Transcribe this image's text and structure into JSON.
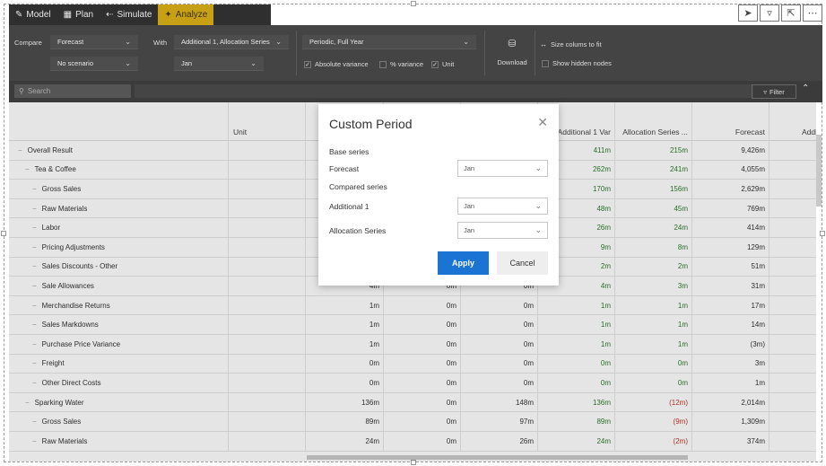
{
  "nav": {
    "tabs": [
      {
        "label": "Model",
        "icon": "wrench-icon"
      },
      {
        "label": "Plan",
        "icon": "table-icon"
      },
      {
        "label": "Simulate",
        "icon": "simulate-icon"
      },
      {
        "label": "Analyze",
        "icon": "analyze-icon",
        "active": true
      }
    ],
    "accent_color": "#c7a015"
  },
  "toolbar": {
    "compare_label": "Compare",
    "compare_value": "Forecast",
    "scenario_value": "No scenario",
    "with_label": "With",
    "with_value": "Additional 1, Allocation Series",
    "with_period": "Jan",
    "period_value": "Periodic, Full Year",
    "abs_variance": "Absolute variance",
    "pct_variance": "% variance",
    "unit": "Unit",
    "download": "Download",
    "size_columns": "Size colums to fit",
    "show_hidden": "Show hidden nodes"
  },
  "search": {
    "placeholder": "Search",
    "filter_label": "Filter"
  },
  "grid": {
    "headers": {
      "unit": "Unit",
      "add1_var": "Additional 1 Var",
      "alloc_series": "Allocation Series ...",
      "forecast": "Forecast",
      "addit": "Addit"
    },
    "rows": [
      {
        "label": "Overall Result",
        "level": 0,
        "c1": "",
        "c2": "",
        "c3": "",
        "c4": "411m",
        "c5": "215m",
        "c6": "9,426m"
      },
      {
        "label": "Tea & Coffee",
        "level": 1,
        "c1": "",
        "c2": "",
        "c3": "",
        "c4": "262m",
        "c5": "241m",
        "c6": "4,055m"
      },
      {
        "label": "Gross Sales",
        "level": 2,
        "c1": "",
        "c2": "",
        "c3": "",
        "c4": "170m",
        "c5": "156m",
        "c6": "2,629m"
      },
      {
        "label": "Raw Materials",
        "level": 2,
        "c1": "",
        "c2": "",
        "c3": "",
        "c4": "48m",
        "c5": "45m",
        "c6": "769m"
      },
      {
        "label": "Labor",
        "level": 2,
        "c1": "",
        "c2": "",
        "c3": "",
        "c4": "26m",
        "c5": "24m",
        "c6": "414m"
      },
      {
        "label": "Pricing Adjustments",
        "level": 2,
        "c1": "",
        "c2": "",
        "c3": "",
        "c4": "9m",
        "c5": "8m",
        "c6": "129m"
      },
      {
        "label": "Sales Discounts - Other",
        "level": 2,
        "c1": "",
        "c2": "",
        "c3": "",
        "c4": "2m",
        "c5": "2m",
        "c6": "51m"
      },
      {
        "label": "Sale Allowances",
        "level": 2,
        "c1": "4m",
        "c2": "0m",
        "c3": "0m",
        "c4": "4m",
        "c5": "3m",
        "c6": "31m"
      },
      {
        "label": "Merchandise Returns",
        "level": 2,
        "c1": "1m",
        "c2": "0m",
        "c3": "0m",
        "c4": "1m",
        "c5": "1m",
        "c6": "17m"
      },
      {
        "label": "Sales Markdowns",
        "level": 2,
        "c1": "1m",
        "c2": "0m",
        "c3": "0m",
        "c4": "1m",
        "c5": "1m",
        "c6": "14m"
      },
      {
        "label": "Purchase Price Variance",
        "level": 2,
        "c1": "1m",
        "c2": "0m",
        "c3": "0m",
        "c4": "1m",
        "c5": "1m",
        "c6": "(3m)"
      },
      {
        "label": "Freight",
        "level": 2,
        "c1": "0m",
        "c2": "0m",
        "c3": "0m",
        "c4": "0m",
        "c5": "0m",
        "c6": "3m"
      },
      {
        "label": "Other Direct Costs",
        "level": 2,
        "c1": "0m",
        "c2": "0m",
        "c3": "0m",
        "c4": "0m",
        "c5": "0m",
        "c6": "1m"
      },
      {
        "label": "Sparking Water",
        "level": 1,
        "c1": "136m",
        "c2": "0m",
        "c3": "148m",
        "c4": "136m",
        "c5": "(12m)",
        "c6": "2,014m"
      },
      {
        "label": "Gross Sales",
        "level": 2,
        "c1": "89m",
        "c2": "0m",
        "c3": "97m",
        "c4": "89m",
        "c5": "(9m)",
        "c6": "1,309m"
      },
      {
        "label": "Raw Materials",
        "level": 2,
        "c1": "24m",
        "c2": "0m",
        "c3": "26m",
        "c4": "24m",
        "c5": "(2m)",
        "c6": "374m"
      }
    ]
  },
  "modal": {
    "title": "Custom Period",
    "base_series": "Base series",
    "forecast_label": "Forecast",
    "forecast_value": "Jan",
    "compared_series": "Compared series",
    "additional_label": "Additional 1",
    "additional_value": "Jan",
    "allocation_label": "Allocation Series",
    "allocation_value": "Jan",
    "apply": "Apply",
    "cancel": "Cancel",
    "apply_color": "#1b74d4"
  }
}
